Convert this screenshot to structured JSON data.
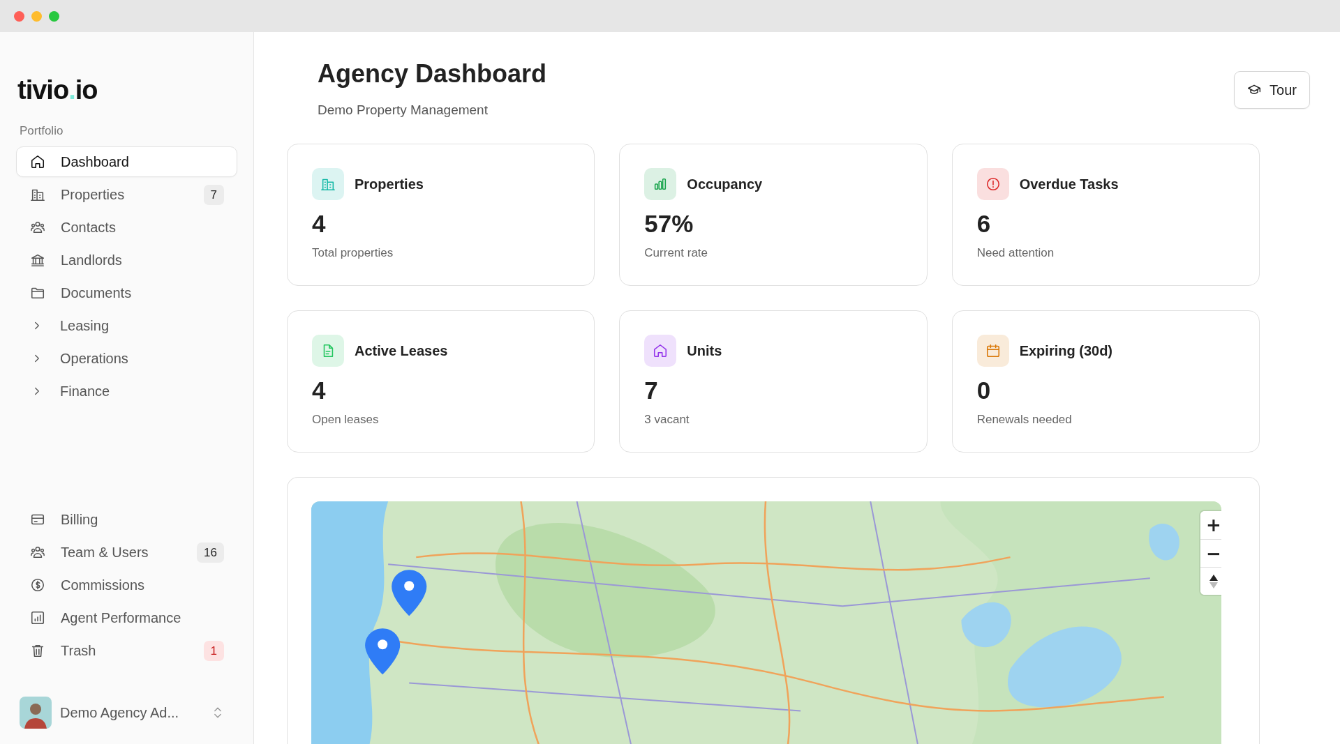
{
  "logo": {
    "name": "tivio",
    "dot": ".",
    "suffix": "io"
  },
  "sidebar": {
    "section": "Portfolio",
    "items": [
      {
        "label": "Dashboard",
        "kind": "link",
        "selected": true
      },
      {
        "label": "Properties",
        "kind": "link",
        "selected": false,
        "badge": "7",
        "badge_alert": false
      },
      {
        "label": "Contacts",
        "kind": "link",
        "selected": false
      },
      {
        "label": "Landlords",
        "kind": "link",
        "selected": false
      },
      {
        "label": "Documents",
        "kind": "link",
        "selected": false
      },
      {
        "label": "Leasing",
        "kind": "group",
        "selected": false,
        "expanded": false
      },
      {
        "label": "Operations",
        "kind": "group",
        "selected": false,
        "expanded": false
      },
      {
        "label": "Finance",
        "kind": "group",
        "selected": false,
        "expanded": false
      }
    ],
    "bottom_items": [
      {
        "label": "Billing",
        "kind": "link",
        "selected": false
      },
      {
        "label": "Team & Users",
        "kind": "link",
        "selected": false,
        "badge": "16",
        "badge_alert": false
      },
      {
        "label": "Commissions",
        "kind": "link",
        "selected": false
      },
      {
        "label": "Agent Performance",
        "kind": "link",
        "selected": false
      },
      {
        "label": "Trash",
        "kind": "link",
        "selected": false,
        "badge": "1",
        "badge_alert": true
      }
    ],
    "user": {
      "name": "Demo Agency Ad..."
    }
  },
  "header": {
    "title": "Agency Dashboard",
    "subtitle": "Demo Property Management",
    "tour_button": "Tour"
  },
  "cards": [
    {
      "title": "Properties",
      "value": "4",
      "caption": "Total properties",
      "color": "#14b8a6"
    },
    {
      "title": "Occupancy",
      "value": "57%",
      "caption": "Current rate",
      "color": "#16a34a"
    },
    {
      "title": "Overdue Tasks",
      "value": "6",
      "caption": "Need attention",
      "color": "#dc2626"
    },
    {
      "title": "Active Leases",
      "value": "4",
      "caption": "Open leases",
      "color": "#22c55e"
    },
    {
      "title": "Units",
      "value": "7",
      "caption": "3 vacant",
      "color": "#9333ea"
    },
    {
      "title": "Expiring (30d)",
      "value": "0",
      "caption": "Renewals needed",
      "color": "#d97706"
    }
  ],
  "map": {
    "kind": "picture",
    "zoom_in": "+",
    "zoom_out": "−"
  }
}
